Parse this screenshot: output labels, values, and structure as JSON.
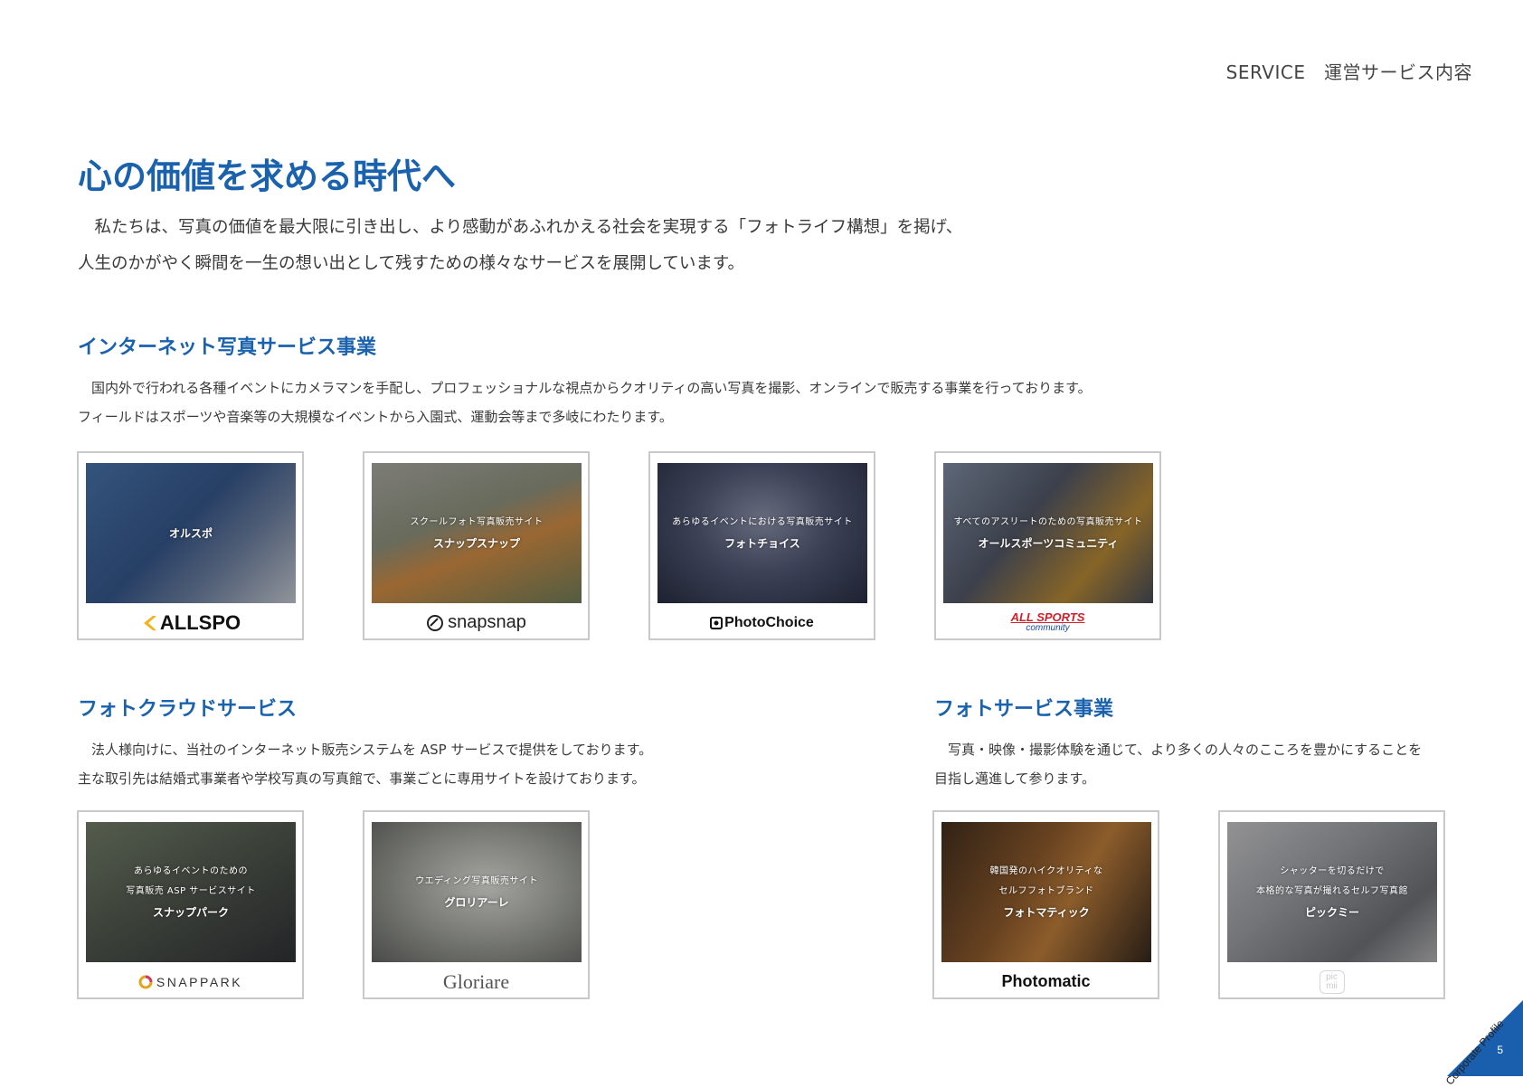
{
  "header": {
    "label": "SERVICE　運営サービス内容"
  },
  "title": "心の価値を求める時代へ",
  "intro": [
    "　私たちは、写真の価値を最大限に引き出し、より感動があふれかえる社会を実現する「フォトライフ構想」を掲げ、",
    "人生のかがやく瞬間を一生の想い出として残すための様々なサービスを展開しています。"
  ],
  "sections": {
    "internet": {
      "title": "インターネット写真サービス事業",
      "desc": [
        "　国内外で行われる各種イベントにカメラマンを手配し、プロフェッショナルな視点からクオリティの高い写真を撮影、オンラインで販売する事業を行っております。",
        "フィールドはスポーツや音楽等の大規模なイベントから入園式、運動会等まで多岐にわたります。"
      ],
      "cards": [
        {
          "caption": "",
          "name": "オルスポ",
          "logo": "ALLSPO",
          "color": "#2b4f86"
        },
        {
          "caption": "スクールフォト写真販売サイト",
          "name": "スナップスナップ",
          "logo": "snapsnap",
          "color": "#6b7a52"
        },
        {
          "caption": "あらゆるイベントにおける写真販売サイト",
          "name": "フォトチョイス",
          "logo": "PhotoChoice",
          "color": "#2c3550"
        },
        {
          "caption": "すべてのアスリートのための写真販売サイト",
          "name": "オールスポーツコミュニティ",
          "logo": "ALL SPORTS",
          "logo_sub": "community",
          "color": "#4a5060"
        }
      ]
    },
    "cloud": {
      "title": "フォトクラウドサービス",
      "desc": [
        "　法人様向けに、当社のインターネット販売システムを ASP サービスで提供をしております。",
        "主な取引先は結婚式事業者や学校写真の写真館で、事業ごとに専用サイトを設けております。"
      ],
      "cards": [
        {
          "caption": [
            "あらゆるイベントのための",
            "写真販売 ASP サービスサイト"
          ],
          "name": "スナップパーク",
          "logo": "SNAPPARK",
          "color": "#4b5346"
        },
        {
          "caption": [
            "ウエディング写真販売サイト"
          ],
          "name": "グロリアーレ",
          "logo": "Gloriare",
          "color": "#7e8078"
        }
      ]
    },
    "photo": {
      "title": "フォトサービス事業",
      "desc": [
        "　写真・映像・撮影体験を通じて、より多くの人々のこころを豊かにすることを",
        "目指し邁進して参ります。"
      ],
      "cards": [
        {
          "caption": [
            "韓国発のハイクオリティな",
            "セルフフォトブランド"
          ],
          "name": "フォトマティック",
          "logo": "Photomatic",
          "color": "#6b3a14"
        },
        {
          "caption": [
            "シャッターを切るだけで",
            "本格的な写真が撮れるセルフ写真館"
          ],
          "name": "ピックミー",
          "logo": "pic mii",
          "color": "#8a8c8e"
        }
      ]
    }
  },
  "footer": {
    "corner_text": "Corporate Profile",
    "page_number": "5"
  }
}
